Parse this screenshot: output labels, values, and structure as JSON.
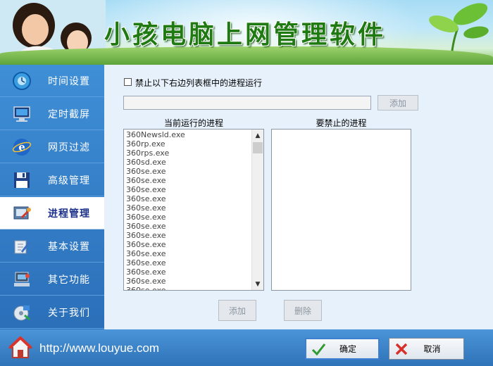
{
  "banner": {
    "title": "小孩电脑上网管理软件"
  },
  "sidebar": {
    "items": [
      {
        "label": "时间设置",
        "icon": "clock-globe-icon"
      },
      {
        "label": "定时截屏",
        "icon": "monitor-screenshot-icon"
      },
      {
        "label": "网页过滤",
        "icon": "browser-e-icon"
      },
      {
        "label": "高级管理",
        "icon": "floppy-disk-icon"
      },
      {
        "label": "进程管理",
        "icon": "process-tools-icon",
        "active": true
      },
      {
        "label": "基本设置",
        "icon": "settings-pen-icon"
      },
      {
        "label": "其它功能",
        "icon": "computer-tools-icon"
      },
      {
        "label": "关于我们",
        "icon": "about-disc-icon"
      }
    ]
  },
  "main": {
    "block_checkbox_label": "禁止以下右边列表框中的进程运行",
    "block_checkbox_checked": false,
    "process_input_value": "",
    "add_top_label": "添加",
    "running_heading": "当前运行的进程",
    "blocked_heading": "要禁止的进程",
    "running_processes": [
      "360Newsld.exe",
      "360rp.exe",
      "360rps.exe",
      "360sd.exe",
      "360se.exe",
      "360se.exe",
      "360se.exe",
      "360se.exe",
      "360se.exe",
      "360se.exe",
      "360se.exe",
      "360se.exe",
      "360se.exe",
      "360se.exe",
      "360se.exe",
      "360se.exe",
      "360se.exe",
      "360se.exe"
    ],
    "blocked_processes": [],
    "add_bottom_label": "添加",
    "delete_bottom_label": "删除"
  },
  "footer": {
    "url": "http://www.louyue.com",
    "ok_label": "确定",
    "cancel_label": "取消"
  },
  "colors": {
    "sidebar_bg": "#2f72b8",
    "panel_bg": "#e7f1fb",
    "title_green": "#1f7a12",
    "active_label": "#1a2f88"
  }
}
